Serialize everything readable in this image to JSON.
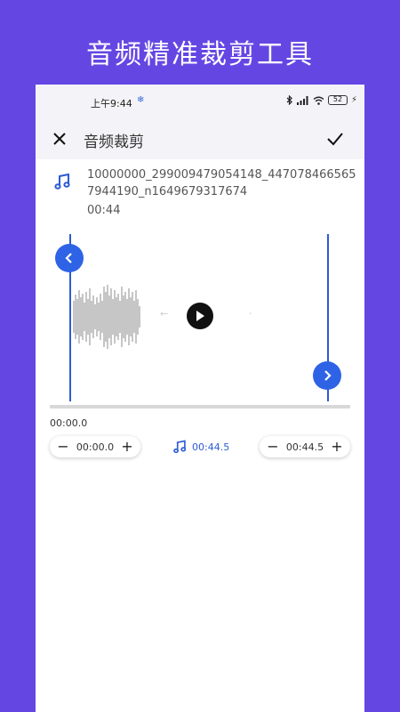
{
  "banner": {
    "title": "音频精准裁剪工具"
  },
  "status_bar": {
    "time": "上午9:44",
    "battery": "52"
  },
  "toolbar": {
    "title": "音频裁剪"
  },
  "file": {
    "name": "10000000_299009479054148_4470784665657944190_n1649679317674",
    "duration": "00:44"
  },
  "timeline": {
    "start_label": "00:00.0"
  },
  "controls": {
    "start_value": "00:00.0",
    "end_value": "00:44.5",
    "selected_duration": "00:44.5",
    "minus_label": "−",
    "plus_label": "+"
  },
  "colors": {
    "background": "#6447e3",
    "accent": "#2e63e6"
  }
}
